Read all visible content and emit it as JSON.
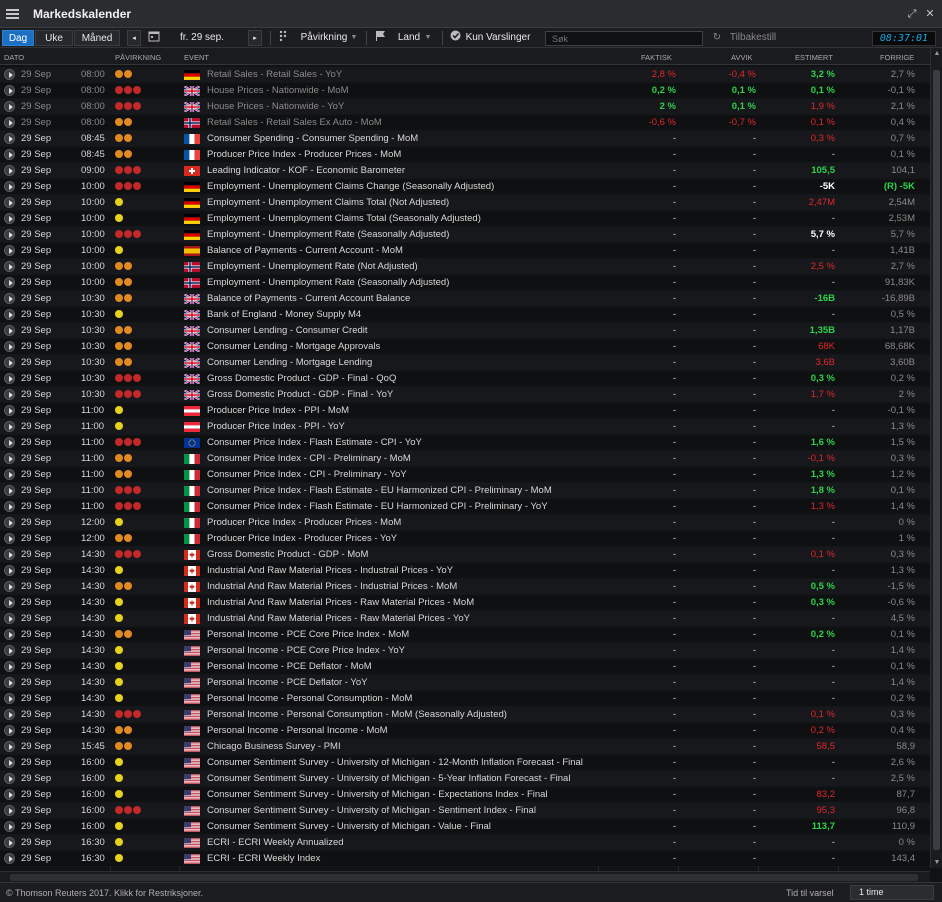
{
  "app": {
    "title": "Markedskalender"
  },
  "toolbar": {
    "tab_day": "Dag",
    "tab_week": "Uke",
    "tab_month": "Måned",
    "date": "fr. 29 sep.",
    "impact": "Påvirkning",
    "country": "Land",
    "alerts_only": "Kun Varslinger",
    "search_placeholder": "Søk",
    "reset": "Tilbakestill",
    "clock": "08:37:01"
  },
  "columns": {
    "date": "DATO",
    "impact": "PÅVIRKNING",
    "event": "EVENT",
    "actual": "FAKTISK",
    "deviation": "AVVIK",
    "estimate": "ESTIMERT",
    "previous": "FORRIGE"
  },
  "flag_colors": {
    "de": [
      "#000000",
      "#dd0000",
      "#ffce00"
    ],
    "fr": [
      "#0055a4",
      "#ffffff",
      "#ef4135"
    ],
    "it": [
      "#009246",
      "#ffffff",
      "#ce2b37"
    ],
    "at": [
      "#ed2939",
      "#ffffff",
      "#ed2939"
    ],
    "es": [
      "#aa151b",
      "#f1bf00",
      "#aa151b"
    ]
  },
  "rows": [
    {
      "date": "29 Sep",
      "time": "08:00",
      "impact": "orange",
      "flag": "de",
      "event": "Retail Sales - Retail Sales - YoY",
      "actual": "2,8 %",
      "actual_c": "red",
      "dev": "-0,4 %",
      "dev_c": "red",
      "est": "3,2 %",
      "est_c": "green",
      "prev": "2,7 %",
      "dim": true
    },
    {
      "date": "29 Sep",
      "time": "08:00",
      "impact": "red",
      "flag": "uk",
      "event": "House Prices - Nationwide - MoM",
      "actual": "0,2 %",
      "actual_c": "green",
      "dev": "0,1 %",
      "dev_c": "green",
      "est": "0,1 %",
      "est_c": "green",
      "prev": "-0,1 %",
      "dim": true
    },
    {
      "date": "29 Sep",
      "time": "08:00",
      "impact": "red",
      "flag": "uk",
      "event": "House Prices - Nationwide - YoY",
      "actual": "2 %",
      "actual_c": "green",
      "dev": "0,1 %",
      "dev_c": "green",
      "est": "1,9 %",
      "est_c": "red",
      "prev": "2,1 %",
      "dim": true
    },
    {
      "date": "29 Sep",
      "time": "08:00",
      "impact": "orange",
      "flag": "no",
      "event": "Retail Sales - Retail Sales Ex Auto - MoM",
      "actual": "-0,6 %",
      "actual_c": "red",
      "dev": "-0,7 %",
      "dev_c": "red",
      "est": "0,1 %",
      "est_c": "red",
      "prev": "0,4 %",
      "dim": true
    },
    {
      "date": "29 Sep",
      "time": "08:45",
      "impact": "orange",
      "flag": "fr",
      "event": "Consumer Spending - Consumer Spending - MoM",
      "actual": "-",
      "dev": "-",
      "est": "0,3 %",
      "est_c": "red",
      "prev": "0,7 %"
    },
    {
      "date": "29 Sep",
      "time": "08:45",
      "impact": "orange",
      "flag": "fr",
      "event": "Producer Price Index - Producer Prices - MoM",
      "actual": "-",
      "dev": "-",
      "est": "-",
      "prev": "0,1 %"
    },
    {
      "date": "29 Sep",
      "time": "09:00",
      "impact": "red",
      "flag": "ch",
      "event": "Leading Indicator - KOF - Economic Barometer",
      "actual": "-",
      "dev": "-",
      "est": "105,5",
      "est_c": "green",
      "prev": "104,1"
    },
    {
      "date": "29 Sep",
      "time": "10:00",
      "impact": "red",
      "flag": "de",
      "event": "Employment - Unemployment Claims Change (Seasonally Adjusted)",
      "actual": "-",
      "dev": "-",
      "est": "-5K",
      "est_c": "white",
      "prev": "(R) -5K",
      "prev_c": "green"
    },
    {
      "date": "29 Sep",
      "time": "10:00",
      "impact": "yellow",
      "flag": "de",
      "event": "Employment - Unemployment Claims Total (Not Adjusted)",
      "actual": "-",
      "dev": "-",
      "est": "2,47M",
      "est_c": "red",
      "prev": "2,54M"
    },
    {
      "date": "29 Sep",
      "time": "10:00",
      "impact": "yellow",
      "flag": "de",
      "event": "Employment - Unemployment Claims Total (Seasonally Adjusted)",
      "actual": "-",
      "dev": "-",
      "est": "-",
      "prev": "2,53M"
    },
    {
      "date": "29 Sep",
      "time": "10:00",
      "impact": "red",
      "flag": "de",
      "event": "Employment - Unemployment Rate (Seasonally Adjusted)",
      "actual": "-",
      "dev": "-",
      "est": "5,7 %",
      "est_c": "white",
      "prev": "5,7 %"
    },
    {
      "date": "29 Sep",
      "time": "10:00",
      "impact": "yellow",
      "flag": "es",
      "event": "Balance of Payments - Current Account - MoM",
      "actual": "-",
      "dev": "-",
      "est": "-",
      "prev": "1,41B"
    },
    {
      "date": "29 Sep",
      "time": "10:00",
      "impact": "orange",
      "flag": "no",
      "event": "Employment - Unemployment Rate (Not Adjusted)",
      "actual": "-",
      "dev": "-",
      "est": "2,5 %",
      "est_c": "red",
      "prev": "2,7 %"
    },
    {
      "date": "29 Sep",
      "time": "10:00",
      "impact": "orange",
      "flag": "no",
      "event": "Employment - Unemployment Rate (Seasonally Adjusted)",
      "actual": "-",
      "dev": "-",
      "est": "-",
      "prev": "91,83K"
    },
    {
      "date": "29 Sep",
      "time": "10:30",
      "impact": "orange",
      "flag": "uk",
      "event": "Balance of Payments - Current Account Balance",
      "actual": "-",
      "dev": "-",
      "est": "-16B",
      "est_c": "green",
      "prev": "-16,89B"
    },
    {
      "date": "29 Sep",
      "time": "10:30",
      "impact": "yellow",
      "flag": "uk",
      "event": "Bank of England - Money Supply M4",
      "actual": "-",
      "dev": "-",
      "est": "-",
      "prev": "0,5 %"
    },
    {
      "date": "29 Sep",
      "time": "10:30",
      "impact": "orange",
      "flag": "uk",
      "event": "Consumer Lending - Consumer Credit",
      "actual": "-",
      "dev": "-",
      "est": "1,35B",
      "est_c": "green",
      "prev": "1,17B"
    },
    {
      "date": "29 Sep",
      "time": "10:30",
      "impact": "orange",
      "flag": "uk",
      "event": "Consumer Lending - Mortgage Approvals",
      "actual": "-",
      "dev": "-",
      "est": "68K",
      "est_c": "red",
      "prev": "68,68K"
    },
    {
      "date": "29 Sep",
      "time": "10:30",
      "impact": "orange",
      "flag": "uk",
      "event": "Consumer Lending - Mortgage Lending",
      "actual": "-",
      "dev": "-",
      "est": "3,6B",
      "est_c": "red",
      "prev": "3,60B"
    },
    {
      "date": "29 Sep",
      "time": "10:30",
      "impact": "red",
      "flag": "uk",
      "event": "Gross Domestic Product - GDP - Final - QoQ",
      "actual": "-",
      "dev": "-",
      "est": "0,3 %",
      "est_c": "green",
      "prev": "0,2 %"
    },
    {
      "date": "29 Sep",
      "time": "10:30",
      "impact": "red",
      "flag": "uk",
      "event": "Gross Domestic Product - GDP - Final - YoY",
      "actual": "-",
      "dev": "-",
      "est": "1,7 %",
      "est_c": "red",
      "prev": "2 %"
    },
    {
      "date": "29 Sep",
      "time": "11:00",
      "impact": "yellow",
      "flag": "at",
      "event": "Producer Price Index - PPI - MoM",
      "actual": "-",
      "dev": "-",
      "est": "-",
      "prev": "-0,1 %"
    },
    {
      "date": "29 Sep",
      "time": "11:00",
      "impact": "yellow",
      "flag": "at",
      "event": "Producer Price Index - PPI - YoY",
      "actual": "-",
      "dev": "-",
      "est": "-",
      "prev": "1,3 %"
    },
    {
      "date": "29 Sep",
      "time": "11:00",
      "impact": "red",
      "flag": "eu",
      "event": "Consumer Price Index - Flash Estimate - CPI - YoY",
      "actual": "-",
      "dev": "-",
      "est": "1,6 %",
      "est_c": "green",
      "prev": "1,5 %"
    },
    {
      "date": "29 Sep",
      "time": "11:00",
      "impact": "orange",
      "flag": "it",
      "event": "Consumer Price Index - CPI - Preliminary - MoM",
      "actual": "-",
      "dev": "-",
      "est": "-0,1 %",
      "est_c": "red",
      "prev": "0,3 %"
    },
    {
      "date": "29 Sep",
      "time": "11:00",
      "impact": "orange",
      "flag": "it",
      "event": "Consumer Price Index - CPI - Preliminary - YoY",
      "actual": "-",
      "dev": "-",
      "est": "1,3 %",
      "est_c": "green",
      "prev": "1,2 %"
    },
    {
      "date": "29 Sep",
      "time": "11:00",
      "impact": "red",
      "flag": "it",
      "event": "Consumer Price Index - Flash Estimate - EU Harmonized CPI - Preliminary - MoM",
      "actual": "-",
      "dev": "-",
      "est": "1,8 %",
      "est_c": "green",
      "prev": "0,1 %"
    },
    {
      "date": "29 Sep",
      "time": "11:00",
      "impact": "red",
      "flag": "it",
      "event": "Consumer Price Index - Flash Estimate - EU Harmonized CPI - Preliminary - YoY",
      "actual": "-",
      "dev": "-",
      "est": "1,3 %",
      "est_c": "red",
      "prev": "1,4 %"
    },
    {
      "date": "29 Sep",
      "time": "12:00",
      "impact": "yellow",
      "flag": "it",
      "event": "Producer Price Index - Producer Prices - MoM",
      "actual": "-",
      "dev": "-",
      "est": "-",
      "prev": "0 %"
    },
    {
      "date": "29 Sep",
      "time": "12:00",
      "impact": "orange",
      "flag": "it",
      "event": "Producer Price Index - Producer Prices - YoY",
      "actual": "-",
      "dev": "-",
      "est": "-",
      "prev": "1 %"
    },
    {
      "date": "29 Sep",
      "time": "14:30",
      "impact": "red",
      "flag": "ca",
      "event": "Gross Domestic Product - GDP - MoM",
      "actual": "-",
      "dev": "-",
      "est": "0,1 %",
      "est_c": "red",
      "prev": "0,3 %"
    },
    {
      "date": "29 Sep",
      "time": "14:30",
      "impact": "yellow",
      "flag": "ca",
      "event": "Industrial And Raw Material Prices - Industrail Prices - YoY",
      "actual": "-",
      "dev": "-",
      "est": "-",
      "prev": "1,3 %"
    },
    {
      "date": "29 Sep",
      "time": "14:30",
      "impact": "orange",
      "flag": "ca",
      "event": "Industrial And Raw Material Prices - Industrial Prices - MoM",
      "actual": "-",
      "dev": "-",
      "est": "0,5 %",
      "est_c": "green",
      "prev": "-1,5 %"
    },
    {
      "date": "29 Sep",
      "time": "14:30",
      "impact": "yellow",
      "flag": "ca",
      "event": "Industrial And Raw Material Prices - Raw Material Prices - MoM",
      "actual": "-",
      "dev": "-",
      "est": "0,3 %",
      "est_c": "green",
      "prev": "-0,6 %"
    },
    {
      "date": "29 Sep",
      "time": "14:30",
      "impact": "yellow",
      "flag": "ca",
      "event": "Industrial And Raw Material Prices - Raw Material Prices - YoY",
      "actual": "-",
      "dev": "-",
      "est": "-",
      "prev": "4,5 %"
    },
    {
      "date": "29 Sep",
      "time": "14:30",
      "impact": "orange",
      "flag": "us",
      "event": "Personal Income - PCE Core Price Index - MoM",
      "actual": "-",
      "dev": "-",
      "est": "0,2 %",
      "est_c": "green",
      "prev": "0,1 %"
    },
    {
      "date": "29 Sep",
      "time": "14:30",
      "impact": "yellow",
      "flag": "us",
      "event": "Personal Income - PCE Core Price Index - YoY",
      "actual": "-",
      "dev": "-",
      "est": "-",
      "prev": "1,4 %"
    },
    {
      "date": "29 Sep",
      "time": "14:30",
      "impact": "yellow",
      "flag": "us",
      "event": "Personal Income - PCE Deflator - MoM",
      "actual": "-",
      "dev": "-",
      "est": "-",
      "prev": "0,1 %"
    },
    {
      "date": "29 Sep",
      "time": "14:30",
      "impact": "yellow",
      "flag": "us",
      "event": "Personal Income - PCE Deflator - YoY",
      "actual": "-",
      "dev": "-",
      "est": "-",
      "prev": "1,4 %"
    },
    {
      "date": "29 Sep",
      "time": "14:30",
      "impact": "yellow",
      "flag": "us",
      "event": "Personal Income - Personal Consumption - MoM",
      "actual": "-",
      "dev": "-",
      "est": "-",
      "prev": "0,2 %"
    },
    {
      "date": "29 Sep",
      "time": "14:30",
      "impact": "red",
      "flag": "us",
      "event": "Personal Income - Personal Consumption - MoM (Seasonally Adjusted)",
      "actual": "-",
      "dev": "-",
      "est": "0,1 %",
      "est_c": "red",
      "prev": "0,3 %"
    },
    {
      "date": "29 Sep",
      "time": "14:30",
      "impact": "orange",
      "flag": "us",
      "event": "Personal Income - Personal Income - MoM",
      "actual": "-",
      "dev": "-",
      "est": "0,2 %",
      "est_c": "red",
      "prev": "0,4 %"
    },
    {
      "date": "29 Sep",
      "time": "15:45",
      "impact": "orange",
      "flag": "us",
      "event": "Chicago Business Survey - PMI",
      "actual": "-",
      "dev": "-",
      "est": "58,5",
      "est_c": "red",
      "prev": "58,9"
    },
    {
      "date": "29 Sep",
      "time": "16:00",
      "impact": "yellow",
      "flag": "us",
      "event": "Consumer Sentiment Survey - University of Michigan - 12-Month Inflation Forecast - Final",
      "actual": "-",
      "dev": "-",
      "est": "-",
      "prev": "2,6 %"
    },
    {
      "date": "29 Sep",
      "time": "16:00",
      "impact": "yellow",
      "flag": "us",
      "event": "Consumer Sentiment Survey - University of Michigan - 5-Year Inflation Forecast - Final",
      "actual": "-",
      "dev": "-",
      "est": "-",
      "prev": "2,5 %"
    },
    {
      "date": "29 Sep",
      "time": "16:00",
      "impact": "yellow",
      "flag": "us",
      "event": "Consumer Sentiment Survey - University of Michigan - Expectations Index - Final",
      "actual": "-",
      "dev": "-",
      "est": "83,2",
      "est_c": "red",
      "prev": "87,7"
    },
    {
      "date": "29 Sep",
      "time": "16:00",
      "impact": "red",
      "flag": "us",
      "event": "Consumer Sentiment Survey - University of Michigan - Sentiment Index - Final",
      "actual": "-",
      "dev": "-",
      "est": "95,3",
      "est_c": "red",
      "prev": "96,8"
    },
    {
      "date": "29 Sep",
      "time": "16:00",
      "impact": "yellow",
      "flag": "us",
      "event": "Consumer Sentiment Survey - University of Michigan - Value - Final",
      "actual": "-",
      "dev": "-",
      "est": "113,7",
      "est_c": "green",
      "prev": "110,9"
    },
    {
      "date": "29 Sep",
      "time": "16:30",
      "impact": "yellow",
      "flag": "us",
      "event": "ECRI - ECRI Weekly Annualized",
      "actual": "-",
      "dev": "-",
      "est": "-",
      "prev": "0 %"
    },
    {
      "date": "29 Sep",
      "time": "16:30",
      "impact": "yellow",
      "flag": "us",
      "event": "ECRI - ECRI Weekly Index",
      "actual": "-",
      "dev": "-",
      "est": "-",
      "prev": "143,4"
    }
  ],
  "status": {
    "copyright": "© Thomson Reuters 2017. Klikk for Restriksjoner.",
    "alert_label": "Tid til varsel",
    "alert_value": "1 time"
  }
}
